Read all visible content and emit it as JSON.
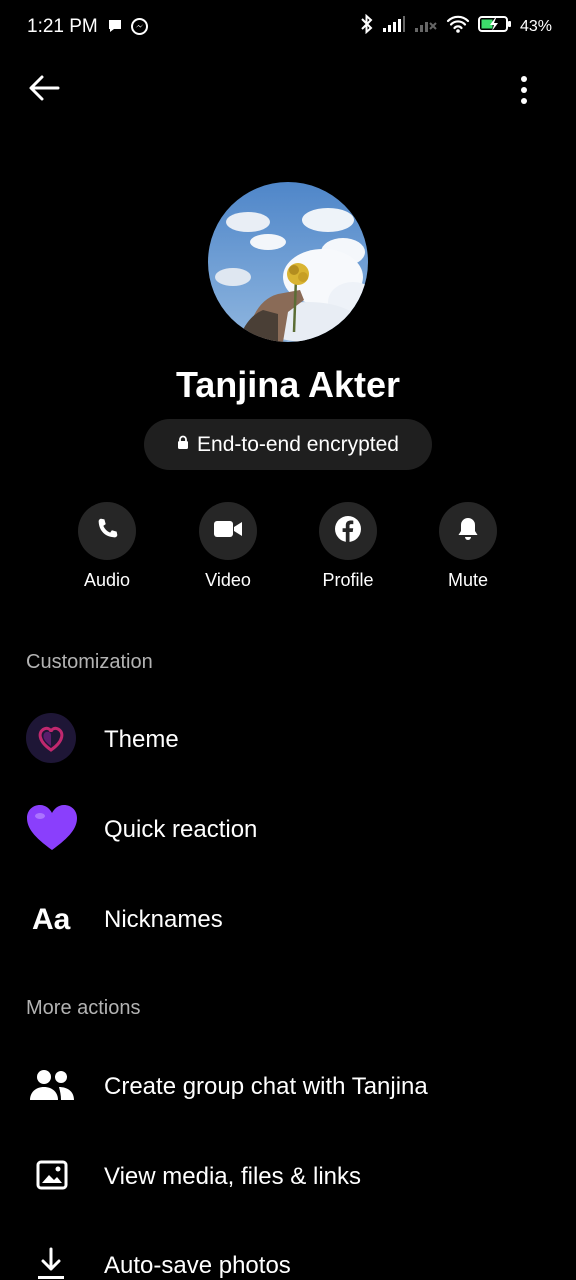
{
  "status_bar": {
    "time": "1:21 PM",
    "battery_percent": "43%",
    "icons": [
      "chat-bubble-icon",
      "messenger-icon",
      "bluetooth-icon",
      "signal-icon",
      "signal-off-icon",
      "wifi-icon",
      "battery-charging-icon"
    ]
  },
  "topbar": {
    "back_icon": "arrow-left-icon",
    "more_icon": "more-vertical-icon"
  },
  "profile": {
    "name": "Tanjina Akter",
    "encryption_label": "End-to-end encrypted",
    "lock_icon": "lock-icon"
  },
  "actions": [
    {
      "label": "Audio",
      "icon": "phone-icon"
    },
    {
      "label": "Video",
      "icon": "video-camera-icon"
    },
    {
      "label": "Profile",
      "icon": "facebook-icon"
    },
    {
      "label": "Mute",
      "icon": "bell-icon"
    }
  ],
  "customization": {
    "title": "Customization",
    "items": [
      {
        "label": "Theme",
        "icon": "theme-heart-icon"
      },
      {
        "label": "Quick reaction",
        "icon": "purple-heart-icon"
      },
      {
        "label": "Nicknames",
        "icon": "text-aa-icon",
        "icon_text": "Aa"
      }
    ]
  },
  "more_actions": {
    "title": "More actions",
    "items": [
      {
        "label": "Create group chat with Tanjina",
        "icon": "group-icon"
      },
      {
        "label": "View media, files & links",
        "icon": "image-icon"
      },
      {
        "label": "Auto-save photos",
        "icon": "download-icon"
      }
    ]
  },
  "colors": {
    "background": "#000000",
    "chip_background": "#1f1f1f",
    "circle_button": "#262626",
    "section_title": "#b3b3b3",
    "accent_purple": "#8a3ffc"
  }
}
